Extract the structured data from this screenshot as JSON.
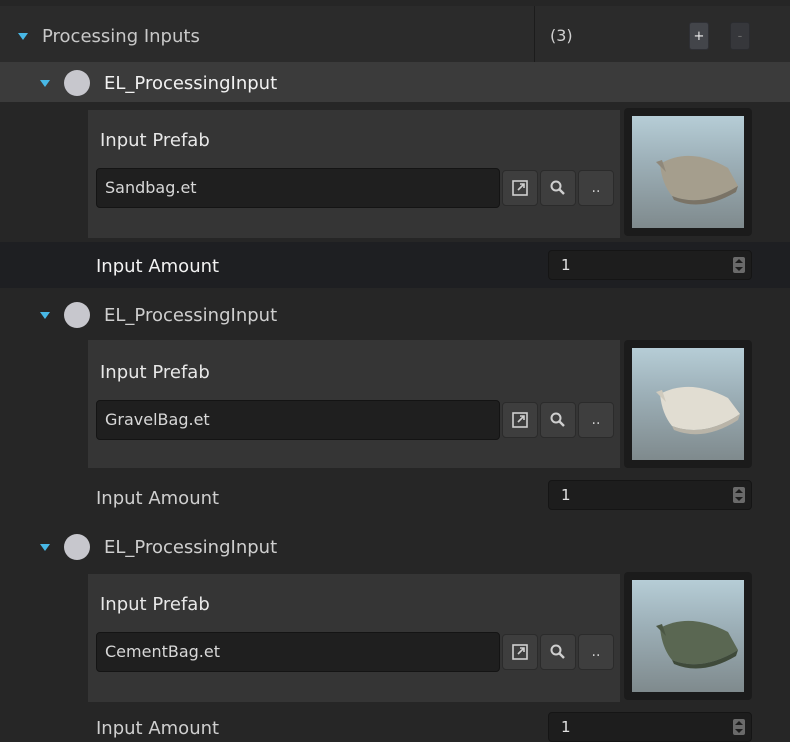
{
  "header": {
    "title": "Processing Inputs",
    "count": "(3)",
    "add_label": "+",
    "remove_label": "-"
  },
  "inputs": [
    {
      "element_label": "EL_ProcessingInput",
      "prefab_label": "Input Prefab",
      "prefab_value": "Sandbag.et",
      "browse_label": "..",
      "thumbnail": "sandbag-thumbnail",
      "amount_label": "Input Amount",
      "amount_value": "1"
    },
    {
      "element_label": "EL_ProcessingInput",
      "prefab_label": "Input Prefab",
      "prefab_value": "GravelBag.et",
      "browse_label": "..",
      "thumbnail": "gravelbag-thumbnail",
      "amount_label": "Input Amount",
      "amount_value": "1"
    },
    {
      "element_label": "EL_ProcessingInput",
      "prefab_label": "Input Prefab",
      "prefab_value": "CementBag.et",
      "browse_label": "..",
      "thumbnail": "cementbag-thumbnail",
      "amount_label": "Input Amount",
      "amount_value": "1"
    }
  ],
  "colors": {
    "accent": "#48b8e6",
    "bag_sand": "#a59e8d",
    "bag_gravel": "#e1ddd2",
    "bag_cement": "#5a6752"
  }
}
